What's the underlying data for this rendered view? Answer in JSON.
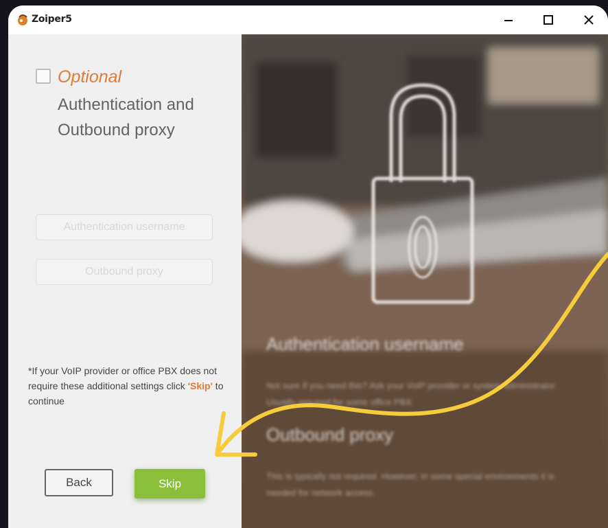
{
  "window": {
    "title": "Zoiper5",
    "controls": {
      "minimize": "minimize-icon",
      "maximize": "maximize-icon",
      "close": "close-icon"
    }
  },
  "left_panel": {
    "optional_checked": false,
    "optional_label": "Optional",
    "heading": "Authentication and Outbound proxy",
    "fields": {
      "auth_username_placeholder": "Authentication username",
      "outbound_proxy_placeholder": "Outbound proxy"
    },
    "note": {
      "prefix": "*If your VoIP provider or office PBX does not require these additional settings click ",
      "skip_word": "'Skip'",
      "suffix": " to continue"
    },
    "buttons": {
      "back": "Back",
      "skip": "Skip"
    }
  },
  "right_panel": {
    "illustration": "lock-icon",
    "blurred_heading_1": "Authentication username",
    "blurred_text_1": "Not sure if you need this? Ask your VoIP provider or system administrator. Usually required for some office PBX.",
    "blurred_heading_2": "Outbound proxy",
    "blurred_text_2": "This is typically not required. However, in some special environments it is needed for network access."
  },
  "colors": {
    "accent_orange": "#e07b39",
    "skip_green": "#8bbf3a",
    "annotation_yellow": "#f6cb3c"
  }
}
